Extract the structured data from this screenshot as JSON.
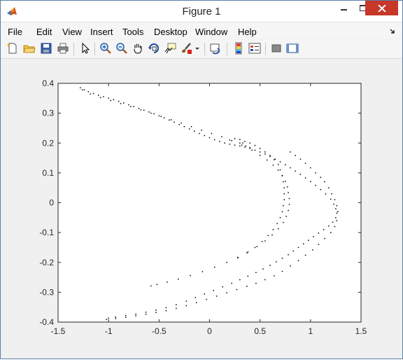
{
  "window": {
    "title": "Figure 1"
  },
  "menu": {
    "items": [
      "File",
      "Edit",
      "View",
      "Insert",
      "Tools",
      "Desktop",
      "Window",
      "Help"
    ]
  },
  "toolbar": {
    "icons": [
      "new-figure-icon",
      "open-file-icon",
      "save-icon",
      "print-icon",
      "edit-plot-arrow-icon",
      "zoom-in-icon",
      "zoom-out-icon",
      "pan-hand-icon",
      "rotate-3d-icon",
      "data-cursor-icon",
      "brush-icon",
      "brush-dropdown-icon",
      "link-plot-icon",
      "insert-colorbar-icon",
      "insert-legend-icon",
      "hide-plot-tools-icon",
      "show-plot-tools-icon"
    ]
  },
  "colors": {
    "marker": "#000000",
    "axes_background": "#ffffff",
    "figure_background": "#f0f0f0"
  },
  "chart_data": {
    "type": "scatter",
    "title": "",
    "xlabel": "",
    "ylabel": "",
    "xlim": [
      -1.5,
      1.5
    ],
    "ylim": [
      -0.4,
      0.4
    ],
    "xticks": [
      "-1.5",
      "-1",
      "-0.5",
      "0",
      "0.5",
      "1",
      "1.5"
    ],
    "yticks": [
      "0.4",
      "0.3",
      "0.2",
      "0.1",
      "0",
      "-0.1",
      "-0.2",
      "-0.3",
      "-0.4"
    ],
    "grid": false,
    "legend": false,
    "series": [
      {
        "description_color": "#000000",
        "points": [
          [
            -1.28,
            0.385
          ],
          [
            -1.24,
            0.378
          ],
          [
            -1.2,
            0.372
          ],
          [
            -1.15,
            0.366
          ],
          [
            -1.1,
            0.36
          ],
          [
            -1.05,
            0.355
          ],
          [
            -1.0,
            0.35
          ],
          [
            -0.95,
            0.345
          ],
          [
            -0.9,
            0.34
          ],
          [
            -0.85,
            0.334
          ],
          [
            -0.8,
            0.328
          ],
          [
            -0.75,
            0.322
          ],
          [
            -0.7,
            0.316
          ],
          [
            -0.65,
            0.31
          ],
          [
            -0.6,
            0.304
          ],
          [
            -0.55,
            0.298
          ],
          [
            -0.5,
            0.291
          ],
          [
            -0.45,
            0.284
          ],
          [
            -0.4,
            0.277
          ],
          [
            -0.35,
            0.27
          ],
          [
            -0.3,
            0.262
          ],
          [
            -0.25,
            0.255
          ],
          [
            -0.2,
            0.247
          ],
          [
            -0.15,
            0.24
          ],
          [
            -0.1,
            0.232
          ],
          [
            -0.05,
            0.225
          ],
          [
            0.0,
            0.218
          ],
          [
            0.05,
            0.211
          ],
          [
            0.1,
            0.205
          ],
          [
            0.15,
            0.2
          ],
          [
            0.2,
            0.196
          ],
          [
            0.25,
            0.193
          ],
          [
            0.3,
            0.19
          ],
          [
            0.35,
            0.186
          ],
          [
            0.4,
            0.182
          ],
          [
            0.45,
            0.176
          ],
          [
            0.5,
            0.17
          ],
          [
            0.55,
            0.163
          ],
          [
            0.6,
            0.155
          ],
          [
            0.65,
            0.146
          ],
          [
            0.7,
            0.137
          ],
          [
            0.75,
            0.127
          ],
          [
            0.8,
            0.117
          ],
          [
            0.85,
            0.106
          ],
          [
            0.9,
            0.095
          ],
          [
            0.95,
            0.083
          ],
          [
            1.0,
            0.071
          ],
          [
            1.05,
            0.058
          ],
          [
            1.1,
            0.044
          ],
          [
            1.15,
            0.029
          ],
          [
            1.2,
            0.012
          ],
          [
            1.23,
            -0.005
          ],
          [
            1.25,
            -0.02
          ],
          [
            1.26,
            -0.035
          ],
          [
            1.25,
            -0.05
          ],
          [
            1.22,
            -0.065
          ],
          [
            1.18,
            -0.078
          ],
          [
            1.13,
            -0.09
          ],
          [
            1.08,
            -0.102
          ],
          [
            1.03,
            -0.114
          ],
          [
            0.98,
            -0.126
          ],
          [
            0.93,
            -0.138
          ],
          [
            0.88,
            -0.15
          ],
          [
            0.83,
            -0.162
          ],
          [
            0.78,
            -0.174
          ],
          [
            0.72,
            -0.186
          ],
          [
            0.66,
            -0.198
          ],
          [
            0.6,
            -0.21
          ],
          [
            0.53,
            -0.222
          ],
          [
            0.46,
            -0.234
          ],
          [
            0.38,
            -0.246
          ],
          [
            0.3,
            -0.258
          ],
          [
            0.22,
            -0.27
          ],
          [
            0.13,
            -0.282
          ],
          [
            0.04,
            -0.294
          ],
          [
            -0.05,
            -0.306
          ],
          [
            -0.14,
            -0.318
          ],
          [
            -0.23,
            -0.33
          ],
          [
            -0.33,
            -0.342
          ],
          [
            -0.43,
            -0.352
          ],
          [
            -0.53,
            -0.36
          ],
          [
            -0.63,
            -0.367
          ],
          [
            -0.73,
            -0.373
          ],
          [
            -0.83,
            -0.378
          ],
          [
            -0.93,
            -0.383
          ],
          [
            -1.0,
            -0.387
          ],
          [
            -1.26,
            0.378
          ],
          [
            -1.18,
            0.364
          ],
          [
            -1.08,
            0.352
          ],
          [
            -0.98,
            0.342
          ],
          [
            -0.88,
            0.332
          ],
          [
            -0.78,
            0.322
          ],
          [
            -0.68,
            0.311
          ],
          [
            -0.58,
            0.3
          ],
          [
            -0.48,
            0.289
          ],
          [
            -0.38,
            0.278
          ],
          [
            -0.28,
            0.267
          ],
          [
            -0.18,
            0.255
          ],
          [
            -0.08,
            0.243
          ],
          [
            0.02,
            0.232
          ],
          [
            0.12,
            0.221
          ],
          [
            0.22,
            0.208
          ],
          [
            0.32,
            0.193
          ],
          [
            0.42,
            0.176
          ],
          [
            0.5,
            0.159
          ],
          [
            0.57,
            0.143
          ],
          [
            0.63,
            0.126
          ],
          [
            0.68,
            0.109
          ],
          [
            0.72,
            0.091
          ],
          [
            0.75,
            0.072
          ],
          [
            0.77,
            0.053
          ],
          [
            0.78,
            0.034
          ],
          [
            0.79,
            0.014
          ],
          [
            0.79,
            -0.006
          ],
          [
            0.78,
            -0.026
          ],
          [
            0.76,
            -0.046
          ],
          [
            0.73,
            -0.066
          ],
          [
            0.68,
            -0.087
          ],
          [
            0.62,
            -0.108
          ],
          [
            0.55,
            -0.128
          ],
          [
            0.47,
            -0.147
          ],
          [
            0.38,
            -0.165
          ],
          [
            0.28,
            -0.183
          ],
          [
            0.17,
            -0.2
          ],
          [
            0.05,
            -0.216
          ],
          [
            -0.07,
            -0.231
          ],
          [
            -0.19,
            -0.244
          ],
          [
            -0.31,
            -0.256
          ],
          [
            -0.42,
            -0.266
          ],
          [
            -0.52,
            -0.274
          ],
          [
            -0.58,
            -0.279
          ],
          [
            0.3,
            0.2
          ],
          [
            0.35,
            0.205
          ],
          [
            0.4,
            0.2
          ],
          [
            0.45,
            0.192
          ],
          [
            0.5,
            0.182
          ],
          [
            0.55,
            0.17
          ],
          [
            0.6,
            0.158
          ],
          [
            0.64,
            0.144
          ],
          [
            0.68,
            0.128
          ],
          [
            0.7,
            0.11
          ],
          [
            0.72,
            0.09
          ],
          [
            0.73,
            0.07
          ],
          [
            0.74,
            0.05
          ],
          [
            0.74,
            0.03
          ],
          [
            0.74,
            0.01
          ],
          [
            0.73,
            -0.01
          ],
          [
            0.72,
            -0.03
          ],
          [
            0.7,
            -0.05
          ],
          [
            0.67,
            -0.07
          ],
          [
            0.63,
            -0.09
          ],
          [
            0.58,
            -0.11
          ],
          [
            0.52,
            -0.13
          ],
          [
            0.45,
            -0.15
          ],
          [
            0.37,
            -0.168
          ],
          [
            0.28,
            -0.185
          ],
          [
            0.2,
            0.21
          ],
          [
            0.25,
            0.215
          ],
          [
            0.3,
            0.212
          ],
          [
            0.33,
            0.2
          ],
          [
            0.36,
            0.19
          ],
          [
            0.4,
            0.185
          ],
          [
            0.8,
            0.17
          ],
          [
            0.85,
            0.158
          ],
          [
            0.9,
            0.146
          ],
          [
            0.95,
            0.132
          ],
          [
            1.0,
            0.117
          ],
          [
            1.05,
            0.1
          ],
          [
            1.1,
            0.085
          ],
          [
            1.14,
            0.07
          ],
          [
            1.18,
            0.05
          ],
          [
            1.21,
            0.03
          ],
          [
            1.24,
            0.01
          ],
          [
            1.26,
            -0.01
          ],
          [
            1.27,
            -0.03
          ],
          [
            1.26,
            -0.06
          ],
          [
            1.24,
            -0.08
          ],
          [
            1.2,
            -0.1
          ],
          [
            1.14,
            -0.12
          ],
          [
            1.08,
            -0.14
          ],
          [
            1.02,
            -0.158
          ],
          [
            0.95,
            -0.176
          ],
          [
            0.88,
            -0.194
          ],
          [
            0.8,
            -0.212
          ],
          [
            0.72,
            -0.23
          ],
          [
            0.64,
            -0.245
          ],
          [
            0.55,
            -0.258
          ],
          [
            0.46,
            -0.27
          ],
          [
            0.37,
            -0.28
          ],
          [
            0.27,
            -0.291
          ],
          [
            0.17,
            -0.302
          ],
          [
            0.07,
            -0.313
          ],
          [
            -0.03,
            -0.324
          ],
          [
            -0.13,
            -0.335
          ],
          [
            -0.23,
            -0.345
          ],
          [
            -0.33,
            -0.354
          ],
          [
            -0.43,
            -0.362
          ],
          [
            -0.53,
            -0.368
          ],
          [
            -0.63,
            -0.374
          ],
          [
            -0.73,
            -0.379
          ],
          [
            -0.83,
            -0.384
          ],
          [
            -0.93,
            -0.388
          ],
          [
            -1.02,
            -0.391
          ]
        ]
      }
    ]
  }
}
